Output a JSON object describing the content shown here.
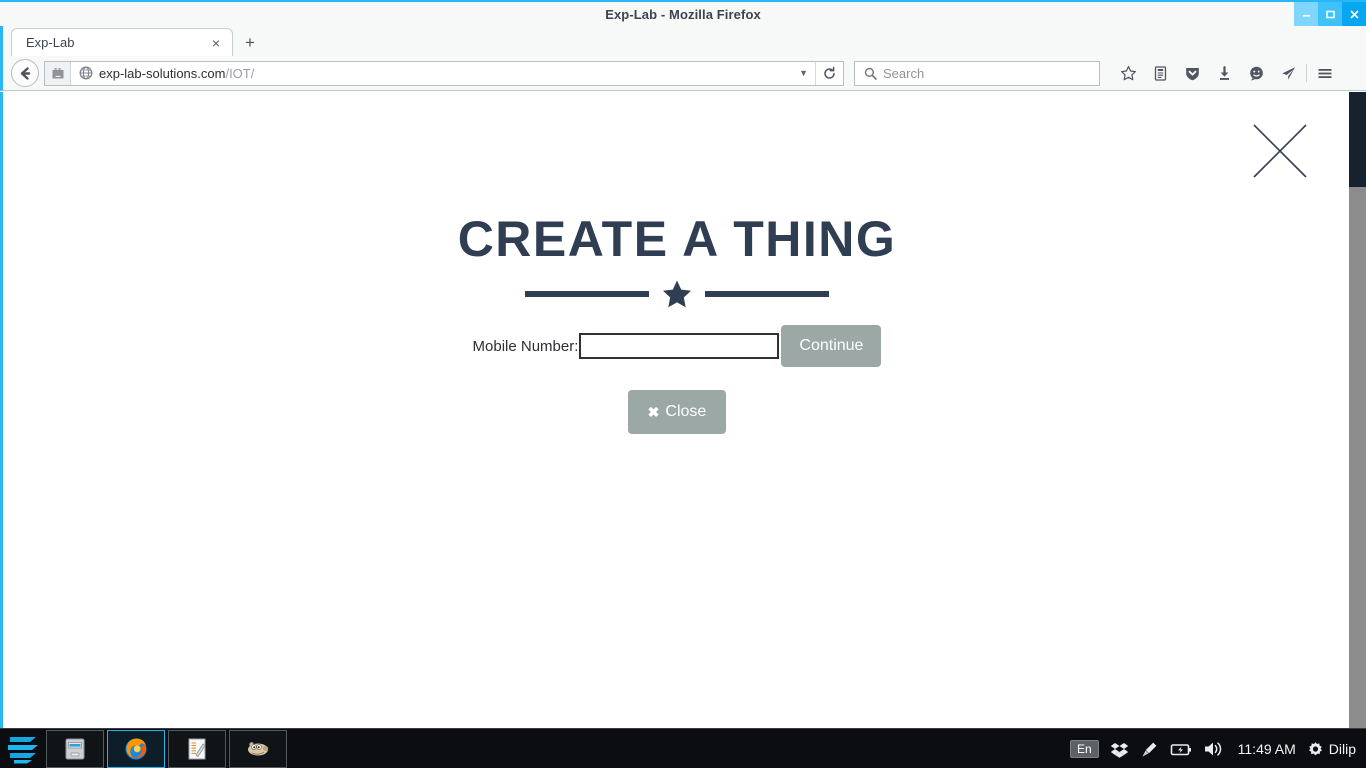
{
  "window": {
    "title": "Exp-Lab - Mozilla Firefox",
    "minimize_label": "Minimize",
    "maximize_label": "Maximize",
    "close_label": "Close"
  },
  "browser": {
    "tab": {
      "title": "Exp-Lab",
      "close_label": "×"
    },
    "new_tab_label": "+",
    "back_label": "Back",
    "url": {
      "domain": "exp-lab-solutions.com",
      "path": "/IOT/",
      "dropdown_glyph": "▼",
      "reload_label": "Reload",
      "identity_icon": "site-identity-icon",
      "globe_icon": "globe-icon"
    },
    "search": {
      "placeholder": "Search",
      "icon": "search-icon"
    },
    "toolbar_icons": [
      {
        "name": "bookmark-star-icon",
        "label": "Bookmark this page"
      },
      {
        "name": "reader-list-icon",
        "label": "Show your bookmarks"
      },
      {
        "name": "pocket-shield-icon",
        "label": "Save to Pocket"
      },
      {
        "name": "download-arrow-icon",
        "label": "Downloads"
      },
      {
        "name": "chat-bubble-icon",
        "label": "Messages"
      },
      {
        "name": "paper-plane-icon",
        "label": "Send"
      },
      {
        "name": "hamburger-menu-icon",
        "label": "Open menu"
      }
    ]
  },
  "page": {
    "heading": "CREATE A THING",
    "close_x_label": "Close overlay",
    "divider_icon": "star-divider-icon",
    "form": {
      "mobile_label": "Mobile Number:",
      "mobile_value": "",
      "mobile_placeholder": "",
      "continue_label": "Continue"
    },
    "close_button": {
      "glyph": "✖",
      "label": "Close"
    },
    "colors": {
      "heading": "#2f3e53",
      "button": "#9ba8a6",
      "input_border": "#2e3238"
    },
    "scrollbar": {
      "thumb_color": "#17222f",
      "track_color": "#8c8c8c"
    }
  },
  "taskbar": {
    "start_icon": "zorin-logo-icon",
    "items": [
      {
        "name": "file-manager",
        "icon": "file-manager-icon",
        "active": false
      },
      {
        "name": "firefox",
        "icon": "firefox-icon",
        "active": true
      },
      {
        "name": "text-editor",
        "icon": "text-editor-icon",
        "active": false
      },
      {
        "name": "gimp",
        "icon": "gimp-wilber-icon",
        "active": false
      }
    ],
    "tray": {
      "language": "En",
      "icons": [
        {
          "name": "dropbox-icon"
        },
        {
          "name": "eyedropper-icon"
        },
        {
          "name": "battery-icon"
        },
        {
          "name": "volume-icon"
        }
      ],
      "clock": "11:49 AM",
      "user": "Dilip",
      "settings_icon": "gear-icon"
    }
  }
}
